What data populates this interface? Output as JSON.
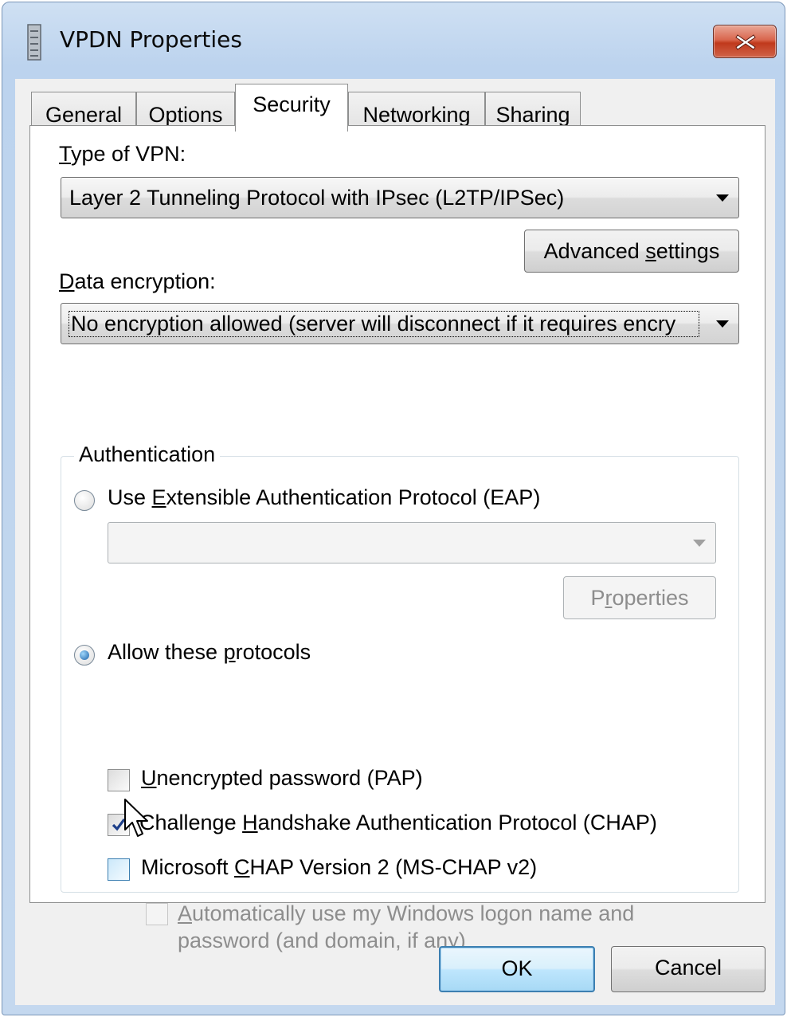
{
  "window": {
    "title": "VPDN Properties",
    "icon": "phone-line-icon"
  },
  "tabs": [
    {
      "label": "General",
      "active": false
    },
    {
      "label": "Options",
      "active": false
    },
    {
      "label": "Security",
      "active": true
    },
    {
      "label": "Networking",
      "active": false
    },
    {
      "label": "Sharing",
      "active": false
    }
  ],
  "security": {
    "vpn_type_label": "Type of VPN:",
    "vpn_type_value": "Layer 2 Tunneling Protocol with IPsec (L2TP/IPSec)",
    "advanced_button": "Advanced settings",
    "encryption_label": "Data encryption:",
    "encryption_value": "No encryption allowed (server will disconnect if it requires encry",
    "authentication": {
      "group_title": "Authentication",
      "eap_label": "Use Extensible Authentication Protocol (EAP)",
      "eap_selected": false,
      "eap_value": "",
      "properties_button": "Properties",
      "allow_label": "Allow these protocols",
      "allow_selected": true,
      "protocols": [
        {
          "label": "Unencrypted password (PAP)",
          "checked": false,
          "enabled": true
        },
        {
          "label": "Challenge Handshake Authentication Protocol (CHAP)",
          "checked": true,
          "enabled": true
        },
        {
          "label": "Microsoft CHAP Version 2 (MS-CHAP v2)",
          "checked": false,
          "enabled": true
        },
        {
          "label": "Automatically use my Windows logon name and password (and domain, if any)",
          "checked": false,
          "enabled": false
        }
      ]
    }
  },
  "footer": {
    "ok": "OK",
    "cancel": "Cancel"
  }
}
